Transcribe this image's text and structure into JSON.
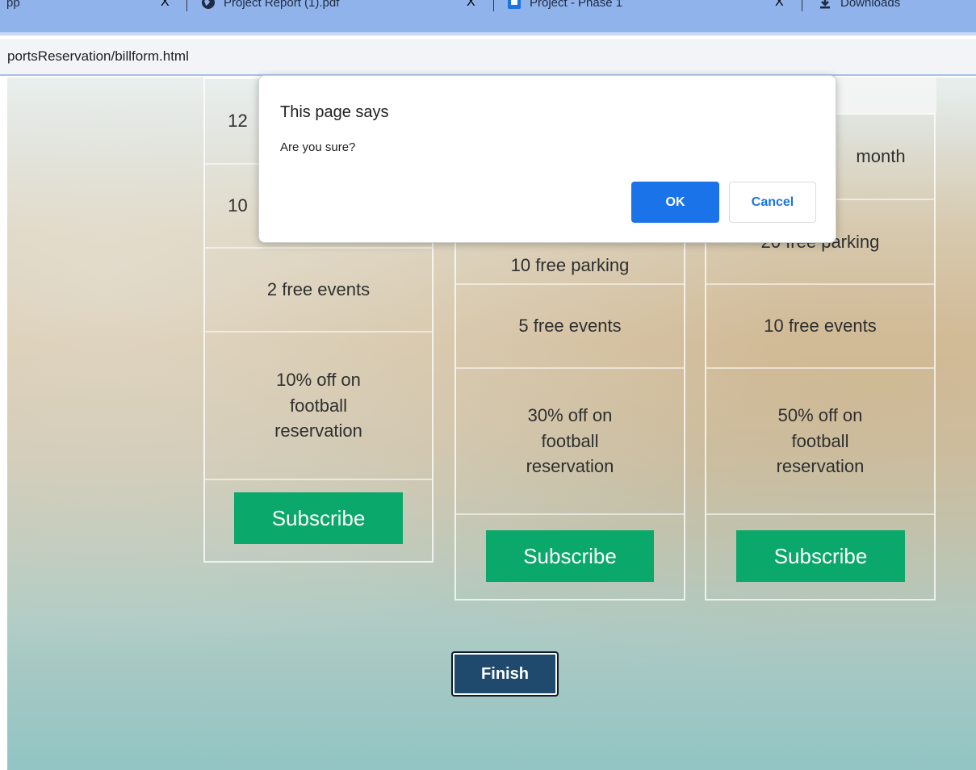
{
  "browser": {
    "tabs": [
      {
        "title": "pp",
        "icon": "app-favicon-icon"
      },
      {
        "title": "Project Report (1).pdf",
        "icon": "globe-icon"
      },
      {
        "title": "Project - Phase 1",
        "icon": "google-slides-icon"
      },
      {
        "title": "Downloads",
        "icon": "download-icon"
      }
    ],
    "tab_close_glyph": "X",
    "address": "portsReservation/billform.html"
  },
  "plans": [
    {
      "rows": [
        "12",
        "10",
        "2 free events",
        "10% off on football reservation"
      ],
      "subscribe_label": "Subscribe"
    },
    {
      "rows": [
        "10 free parking",
        "5 free events",
        "30% off on football reservation"
      ],
      "subscribe_label": "Subscribe"
    },
    {
      "rows": [
        "month",
        "20 free parking",
        "10 free events",
        "50% off on football reservation"
      ],
      "subscribe_label": "Subscribe"
    }
  ],
  "finish_label": "Finish",
  "dialog": {
    "title": "This page says",
    "message": "Are you sure?",
    "ok_label": "OK",
    "cancel_label": "Cancel"
  },
  "colors": {
    "subscribe_green": "#0aa86a",
    "finish_navy": "#1f4a6e",
    "dialog_accent": "#1a73e8",
    "tabbar": "#8fb3ea"
  }
}
